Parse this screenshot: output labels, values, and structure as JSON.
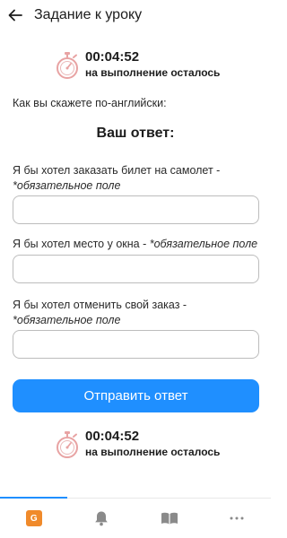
{
  "header": {
    "title": "Задание к уроку",
    "back_icon": "arrow-left-icon"
  },
  "timer": {
    "time": "00:04:52",
    "note": "на выполнение осталось",
    "icon": "stopwatch-icon",
    "icon_color": "#e8a3a3"
  },
  "prompt": "Как вы скажете по-английски:",
  "answer_title": "Ваш ответ:",
  "questions": [
    {
      "label": "Я бы хотел заказать билет на самолет -",
      "required": "*обязательное поле",
      "value": "",
      "placeholder": ""
    },
    {
      "label": "Я бы хотел место у окна -",
      "required": "*обязательное поле",
      "value": "",
      "placeholder": ""
    },
    {
      "label": "Я бы хотел отменить свой заказ -",
      "required": "*обязательное поле",
      "value": "",
      "placeholder": ""
    }
  ],
  "submit_label": "Отправить ответ",
  "accent_color": "#1f8fff",
  "bottom_nav": {
    "active_index": 0,
    "items": [
      {
        "icon": "g-badge-icon",
        "badge": "G",
        "color": "#f08a2b"
      },
      {
        "icon": "bell-icon"
      },
      {
        "icon": "book-icon"
      },
      {
        "icon": "more-dots-icon"
      }
    ]
  }
}
